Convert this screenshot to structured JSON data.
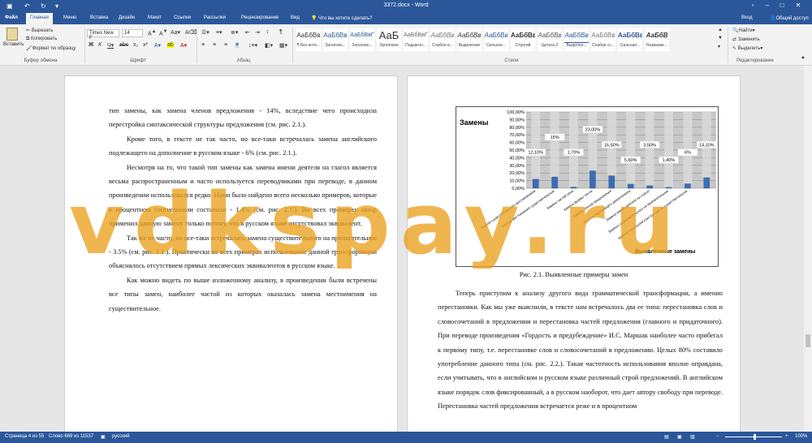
{
  "window": {
    "doc_title": "3372.docx - Word"
  },
  "tabs": {
    "items": [
      "Файл",
      "Главная",
      "Меню",
      "Вставка",
      "Дизайн",
      "Макет",
      "Ссылки",
      "Рассылки",
      "Рецензирование",
      "Вид"
    ],
    "tell_me": "Что вы хотите сделать?",
    "user": "Вход",
    "share": "Общий доступ"
  },
  "ribbon": {
    "paste": "Вставить",
    "cut": "Вырезать",
    "copy": "Копировать",
    "format_painter": "Формат по образцу",
    "clipboard_group": "Буфер обмена",
    "font_name": "Times New F",
    "font_size": "14",
    "font_group": "Шрифт",
    "paragraph_group": "Абзац",
    "styles": [
      {
        "preview": "АаБбВв",
        "name": "¶ Без инте..."
      },
      {
        "preview": "АаБбВв",
        "name": "Заголово..."
      },
      {
        "preview": "АаБбВвГ",
        "name": "Заголово..."
      },
      {
        "preview": "АаБ",
        "name": "Заголовок"
      },
      {
        "preview": "АаБбВвГ",
        "name": "Подзагол..."
      },
      {
        "preview": "АаБбВв",
        "name": "Слабое в..."
      },
      {
        "preview": "АаБбВв",
        "name": "Выделение"
      },
      {
        "preview": "АаБбВв",
        "name": "Сильное..."
      },
      {
        "preview": "АаБбВв",
        "name": "Строгий"
      },
      {
        "preview": "АаБбВв",
        "name": "Цитата 2"
      },
      {
        "preview": "АаБбВв",
        "name": "Выделен..."
      },
      {
        "preview": "АаБбВв",
        "name": "Слабая сс..."
      },
      {
        "preview": "АаБбВв",
        "name": "Сильная..."
      },
      {
        "preview": "АаБбВ",
        "name": "Название..."
      }
    ],
    "styles_group": "Стили",
    "find": "Найти",
    "replace": "Заменить",
    "select": "Выделить",
    "editing_group": "Редактирование"
  },
  "document": {
    "left_paragraphs": [
      "тип замены, как замена членов предложения - 14%, вследствие чего происходила перестройка синтаксической структуры предложения (см. рис. 2.1.).",
      "Кроме того, в тексте не так часто, но все-таки встречалась замена английского подлежащего на дополнение в русском языке - 6% (см. рис. 2.1.).",
      "Несмотря на то, что такой тип замены как замена имени деятеля на глагол является весьма распространенным и часто используется переводчиками при переводе, в данном произведении использовался редко. Нами было найдено всего несколько примеров, которые в процентном соотношении составили - 1.4% (см. рис. 2.1.). Во всех примерах автор применил данную замену только потому, что в русском языке отсутствовал эквивалент.",
      "Так же не часто, но все-таки встречалась замена существительного на прилагательное - 3.5% (см. рис. 2.1.). Практически во всех примерах использование данной трансформации объяснялось отсутствием прямых лексических эквивалентов в русском языке.",
      "Как можно видеть по выше изложенному анализу, в произведении были встречены все типы замен, наиболее частой из которых оказалась замена местоимения на существительное."
    ],
    "figure_caption": "Рис. 2.1. Выявленные примеры замен",
    "right_text": "Теперь приступим к анализу другого вида грамматической трансформации, а именно перестановки. Как мы уже выяснили, в тексте нам встречалось два ее типа: перестановка слов и словосочетаний в предложении и перестановка частей предложения (главного и придаточного). При переводе произведения «Гордость и предубеждение» И.С. Маршак наиболее часто прибегал к первому типу, т.е. перестановке слов и словосочетаний в предложении. Целых 80% составило употребление данного типа (см. рис. 2.2.). Такая частотность использования вполне оправдана, если учитывать, что в английском и русском языке различный строй предложений. В английском языке порядок слов фиксированный, а в русском наоборот, что дает автору свободу при переводе. Перестановка частей предложения встречается реже и в процентном"
  },
  "chart_data": {
    "type": "bar",
    "title": "Замены",
    "xlabel": "Выявленные замены",
    "ylabel": "",
    "ylim": [
      0,
      100
    ],
    "y_ticks": [
      "100,00%",
      "90,00%",
      "80,00%",
      "70,00%",
      "60,00%",
      "50,00%",
      "40,00%",
      "30,00%",
      "20,00%",
      "10,00%",
      "0,00%"
    ],
    "categories": [
      "Замена существительного местоимением",
      "Замена местоимения существительным",
      "Замена частей речи",
      "Замена формы числа",
      "Замена членов предложения",
      "Замена подлежащего дополнением",
      "Замена имени деятеля на глагол",
      "Замена существительного на прилагательное",
      "Замена глагольной конструкции на существительное"
    ],
    "values": [
      12.1,
      15,
      1.7,
      23,
      16.5,
      5.6,
      3.5,
      1.4,
      6,
      14.1
    ],
    "data_labels": [
      "12,10%",
      "15%",
      "1,70%",
      "23,00%",
      "16,50%",
      "5,60%",
      "3,50%",
      "1,40%",
      "6%",
      "14,10%"
    ],
    "grid": true
  },
  "watermark": "vdkspay.ru",
  "status": {
    "page": "Страница 4 из 55",
    "words": "Слово 669 из 11537",
    "lang": "русский",
    "zoom": "100%"
  },
  "colors": {
    "accent": "#2b579a",
    "watermark": "#eba01e",
    "bar": "#d8d8d8"
  }
}
